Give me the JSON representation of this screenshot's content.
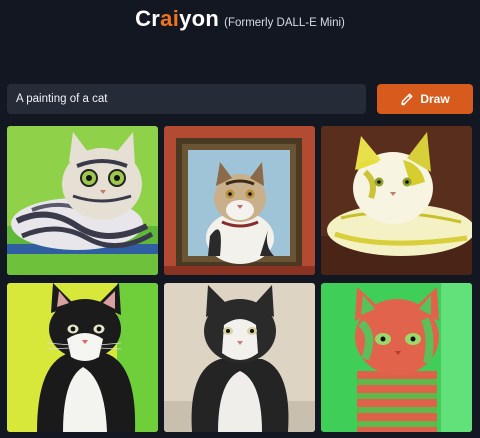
{
  "header": {
    "logo_part1": "Cr",
    "logo_part2": "ai",
    "logo_part3": "yon",
    "subtitle": "(Formerly DALL-E Mini)"
  },
  "search": {
    "value": "A painting of a cat",
    "draw_label": "Draw",
    "draw_icon": "pencil-icon"
  },
  "colors": {
    "background": "#131722",
    "input_bg": "#262b38",
    "accent": "#d85b1e"
  },
  "results": [
    {
      "subject": "tabby cat lying on grass, green background"
    },
    {
      "subject": "framed portrait of a tabby cat on red wall"
    },
    {
      "subject": "cat with white and yellow fur on brown background"
    },
    {
      "subject": "black and white cat on yellow-green background"
    },
    {
      "subject": "black and white cat on beige background"
    },
    {
      "subject": "red and green striped cat"
    }
  ]
}
